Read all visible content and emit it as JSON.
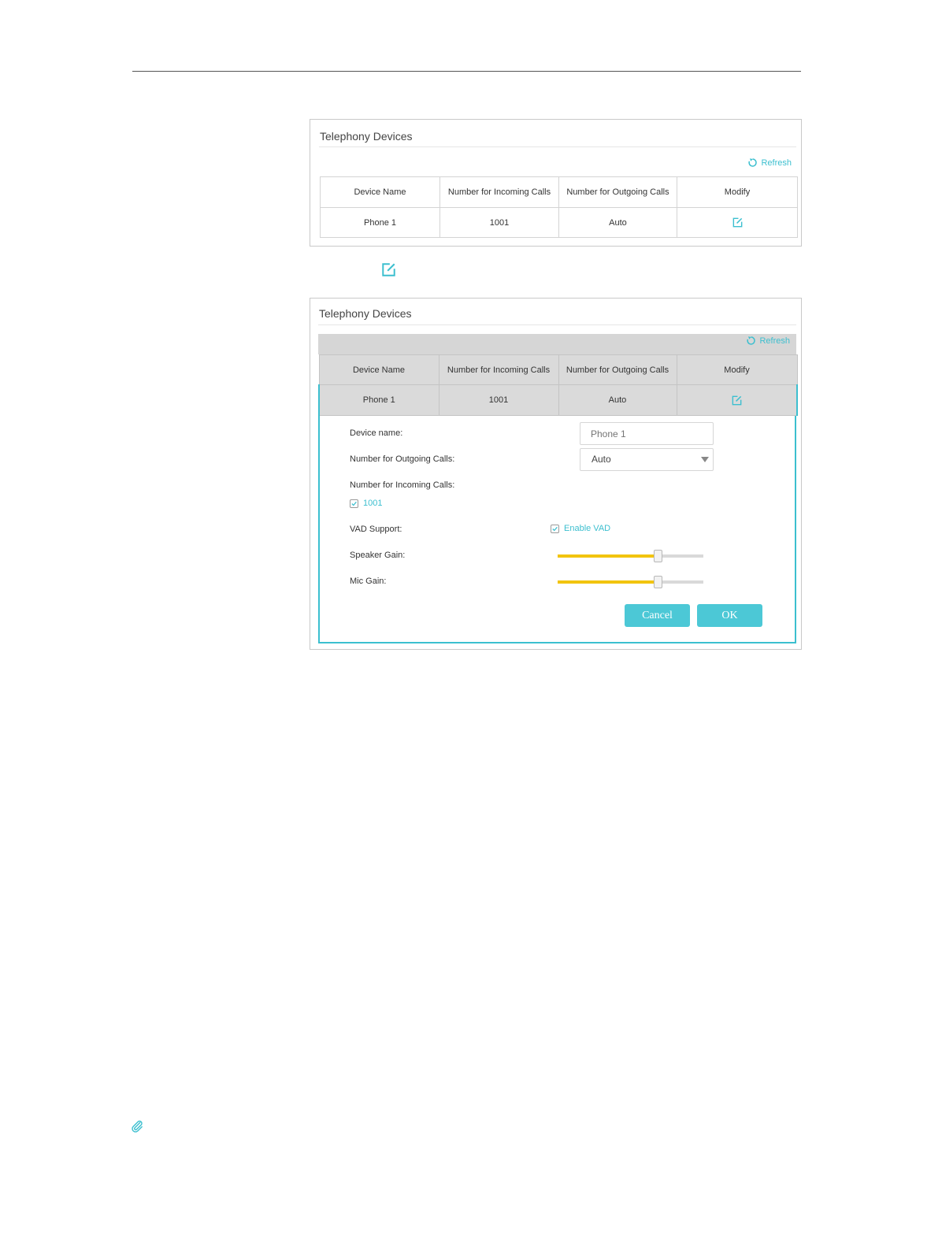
{
  "panel_top": {
    "title": "Telephony Devices",
    "refresh_label": "Refresh",
    "columns": [
      "Device Name",
      "Number for Incoming Calls",
      "Number for Outgoing Calls",
      "Modify"
    ],
    "rows": [
      {
        "device_name": "Phone 1",
        "incoming": "1001",
        "outgoing": "Auto"
      }
    ]
  },
  "panel_edit": {
    "title": "Telephony Devices",
    "refresh_label": "Refresh",
    "columns": [
      "Device Name",
      "Number for Incoming Calls",
      "Number for Outgoing Calls",
      "Modify"
    ],
    "rows": [
      {
        "device_name": "Phone 1",
        "incoming": "1001",
        "outgoing": "Auto"
      }
    ],
    "form": {
      "device_name_label": "Device name:",
      "device_name_placeholder": "Phone 1",
      "outgoing_label": "Number for Outgoing Calls:",
      "outgoing_value": "Auto",
      "incoming_label": "Number for Incoming Calls:",
      "incoming_option": "1001",
      "incoming_checked": true,
      "vad_label": "VAD Support:",
      "vad_option": "Enable VAD",
      "vad_checked": true,
      "speaker_gain_label": "Speaker Gain:",
      "speaker_gain_level": 0.69,
      "mic_gain_label": "Mic Gain:",
      "mic_gain_level": 0.69,
      "cancel_label": "Cancel",
      "ok_label": "OK"
    }
  },
  "colors": {
    "accent": "#3cbfcf",
    "button": "#4cc8d6",
    "slider_fill": "#f2c40e",
    "row_selected_bg": "#dadada"
  },
  "icons": {
    "refresh": "refresh-icon",
    "edit": "edit-icon",
    "note": "paperclip-icon",
    "check": "check-icon"
  }
}
